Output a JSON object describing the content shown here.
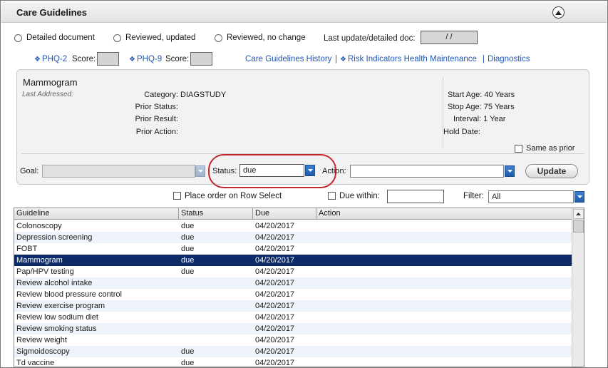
{
  "header": {
    "title": "Care Guidelines"
  },
  "review_options": {
    "detailed": "Detailed document",
    "reviewed_updated": "Reviewed, updated",
    "reviewed_no_change": "Reviewed, no change",
    "last_update_label": "Last update/detailed doc:",
    "last_update_value": "/ /"
  },
  "links": {
    "phq2": "PHQ-2",
    "phq9": "PHQ-9",
    "score_label": "Score:",
    "history": "Care Guidelines History",
    "risk": "Risk Indicators Health Maintenance",
    "diagnostics": "Diagnostics",
    "separator": "|"
  },
  "detail": {
    "title": "Mammogram",
    "last_addressed": "Last Addressed:",
    "category_label": "Category:",
    "category_value": "DIAGSTUDY",
    "prior_status_label": "Prior Status:",
    "prior_result_label": "Prior Result:",
    "prior_action_label": "Prior Action:",
    "start_age": "Start Age: 40 Years",
    "stop_age": "Stop Age: 75 Years",
    "interval": "Interval: 1 Year",
    "hold_date": "Hold Date:",
    "same_as_prior": "Same as prior"
  },
  "form": {
    "goal_label": "Goal:",
    "goal_value": "",
    "status_label": "Status:",
    "status_value": "due",
    "action_label": "Action:",
    "action_value": "",
    "update_button": "Update"
  },
  "options": {
    "place_order": "Place order on Row Select",
    "due_within": "Due within:",
    "filter_label": "Filter:",
    "filter_value": "All"
  },
  "table": {
    "columns": [
      "Guideline",
      "Status",
      "Due",
      "Action"
    ],
    "selected_index": 3,
    "rows": [
      [
        "Colonoscopy",
        "due",
        "04/20/2017",
        ""
      ],
      [
        "Depression screening",
        "due",
        "04/20/2017",
        ""
      ],
      [
        "FOBT",
        "due",
        "04/20/2017",
        ""
      ],
      [
        "Mammogram",
        "due",
        "04/20/2017",
        ""
      ],
      [
        "Pap/HPV testing",
        "due",
        "04/20/2017",
        ""
      ],
      [
        "Review alcohol intake",
        "",
        "04/20/2017",
        ""
      ],
      [
        "Review blood pressure control",
        "",
        "04/20/2017",
        ""
      ],
      [
        "Review exercise program",
        "",
        "04/20/2017",
        ""
      ],
      [
        "Review low sodium diet",
        "",
        "04/20/2017",
        ""
      ],
      [
        "Review smoking status",
        "",
        "04/20/2017",
        ""
      ],
      [
        "Review weight",
        "",
        "04/20/2017",
        ""
      ],
      [
        "Sigmoidoscopy",
        "due",
        "04/20/2017",
        ""
      ],
      [
        "Td vaccine",
        "due",
        "04/20/2017",
        ""
      ]
    ]
  },
  "colors": {
    "link": "#2155b5",
    "selection": "#0b2a66",
    "highlight_ring": "#c0282d",
    "dropdown_button": "#1e5aa8"
  }
}
